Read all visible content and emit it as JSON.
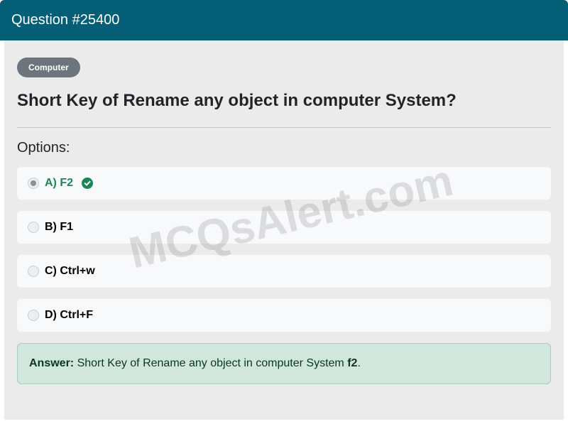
{
  "header": {
    "title": "Question #25400"
  },
  "category": {
    "label": "Computer"
  },
  "question": {
    "text": "Short Key of Rename any object in computer System?"
  },
  "options_label": "Options:",
  "options": [
    {
      "label": "A) F2",
      "correct": true,
      "selected": true
    },
    {
      "label": "B) F1",
      "correct": false,
      "selected": false
    },
    {
      "label": "C) Ctrl+w",
      "correct": false,
      "selected": false
    },
    {
      "label": "D) Ctrl+F",
      "correct": false,
      "selected": false
    }
  ],
  "answer": {
    "label": "Answer:",
    "text": "Short Key of Rename any object in computer System",
    "value": "f2",
    "suffix": "."
  },
  "watermark": "MCQsAlert.com",
  "colors": {
    "header": "#045e75",
    "correct": "#198754",
    "answer_bg": "#d1e7dd"
  },
  "icons": {
    "correct": "check-circle-icon"
  }
}
